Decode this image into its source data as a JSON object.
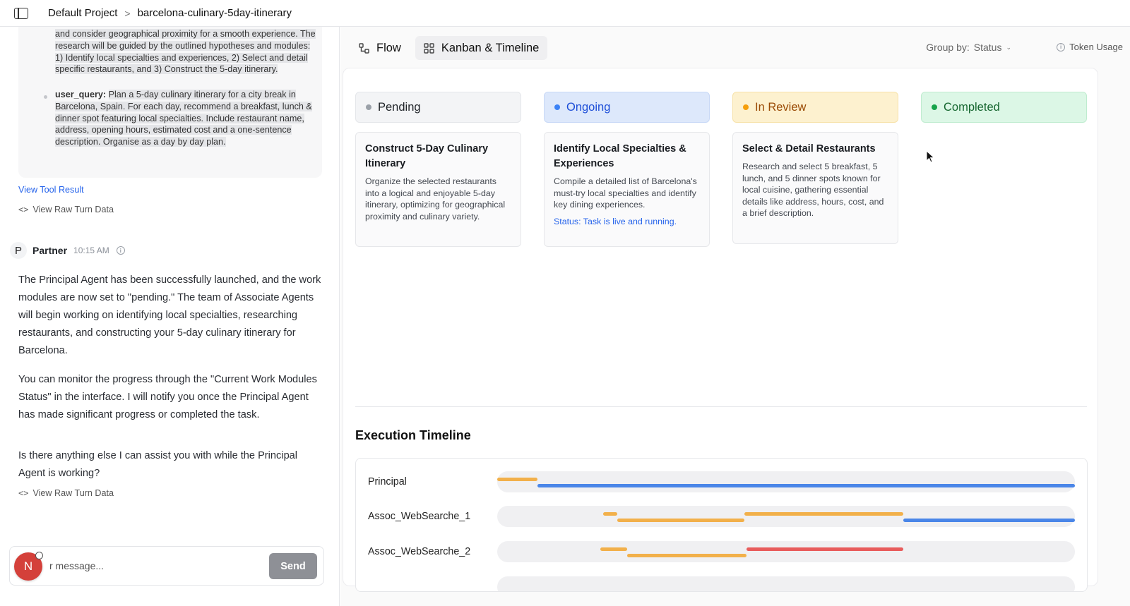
{
  "breadcrumb": {
    "project": "Default Project",
    "separator": ">",
    "page": "barcelona-culinary-5day-itinerary"
  },
  "left": {
    "quote_text": "and consider geographical proximity for a smooth experience. The research will be guided by the outlined hypotheses and modules: 1) Identify local specialties and experiences, 2) Select and detail specific restaurants, and 3) Construct the 5-day itinerary.",
    "query_key": "user_query:",
    "query_value": "Plan a 5-day culinary itinerary for a city break in Barcelona, Spain. For each day, recommend a breakfast, lunch & dinner spot featuring local specialties. Include restaurant name, address, opening hours, estimated cost and a one-sentence description. Organise as a day by day plan.",
    "view_tool_result": "View Tool Result",
    "view_raw_1": "View Raw Turn Data",
    "partner_initial": "P",
    "partner_name": "Partner",
    "partner_time": "10:15 AM",
    "msg1": "The Principal Agent has been successfully launched, and the work modules are now set to \"pending.\" The team of Associate Agents will begin working on identifying local specialties, researching restaurants, and constructing your 5-day culinary itinerary for Barcelona.",
    "msg2": "You can monitor the progress through the \"Current Work Modules Status\" in the interface. I will notify you once the Principal Agent has made significant progress or completed the task.",
    "msg3": "Is there anything else I can assist you with while the Principal Agent is working?",
    "view_raw_2": "View Raw Turn Data",
    "composer_placeholder": "r message...",
    "send_label": "Send",
    "user_initial": "N"
  },
  "tabs": [
    {
      "label": "Flow",
      "icon": "flow-icon"
    },
    {
      "label": "Kanban & Timeline",
      "icon": "grid-icon"
    }
  ],
  "toolbar": {
    "group_by_label": "Group by:",
    "group_by_value": "Status",
    "token_usage": "Token Usage"
  },
  "columns": [
    {
      "label": "Pending",
      "dot": "#9aa0a8",
      "bg": "#f3f4f6",
      "border": "#e4e6ea",
      "text": "#1f2328"
    },
    {
      "label": "Ongoing",
      "dot": "#3b82f6",
      "bg": "#dde8fb",
      "border": "#c8d8f6",
      "text": "#1d4ed8"
    },
    {
      "label": "In Review",
      "dot": "#f59e0b",
      "bg": "#fdf1cf",
      "border": "#f7e2a9",
      "text": "#9a4a05"
    },
    {
      "label": "Completed",
      "dot": "#16a34a",
      "bg": "#dcf7e6",
      "border": "#bfeccf",
      "text": "#15662f"
    }
  ],
  "cards": {
    "pending": {
      "title": "Construct 5-Day Culinary Itinerary",
      "desc": "Organize the selected restaurants into a logical and enjoyable 5-day itinerary, optimizing for geographical proximity and culinary variety."
    },
    "ongoing": {
      "title": "Identify Local Specialties & Experiences",
      "desc": "Compile a detailed list of Barcelona's must-try local specialties and identify key dining experiences.",
      "status": "Status: Task is live and running."
    },
    "review": {
      "title": "Select & Detail Restaurants",
      "desc": "Research and select 5 breakfast, 5 lunch, and 5 dinner spots known for local cuisine, gathering essential details like address, hours, cost, and a brief description."
    }
  },
  "timeline": {
    "title": "Execution Timeline",
    "rows": [
      {
        "label": "Principal",
        "segments": [
          {
            "start": 0.0,
            "end": 0.07,
            "lane": "top",
            "color": "#f2b04a"
          },
          {
            "start": 0.07,
            "end": 1.0,
            "lane": "bottom",
            "color": "#4a86e8"
          }
        ]
      },
      {
        "label": "Assoc_WebSearche_1",
        "segments": [
          {
            "start": 0.183,
            "end": 0.208,
            "lane": "top",
            "color": "#f2b04a"
          },
          {
            "start": 0.208,
            "end": 0.428,
            "lane": "bottom",
            "color": "#f2b04a"
          },
          {
            "start": 0.428,
            "end": 0.703,
            "lane": "top",
            "color": "#f2b04a"
          },
          {
            "start": 0.703,
            "end": 1.0,
            "lane": "bottom",
            "color": "#4a86e8"
          }
        ]
      },
      {
        "label": "Assoc_WebSearche_2",
        "segments": [
          {
            "start": 0.179,
            "end": 0.225,
            "lane": "top",
            "color": "#f2b04a"
          },
          {
            "start": 0.225,
            "end": 0.431,
            "lane": "bottom",
            "color": "#f2b04a"
          },
          {
            "start": 0.431,
            "end": 0.703,
            "lane": "top",
            "color": "#e85c5c"
          }
        ]
      },
      {
        "label": "",
        "segments": []
      }
    ]
  }
}
